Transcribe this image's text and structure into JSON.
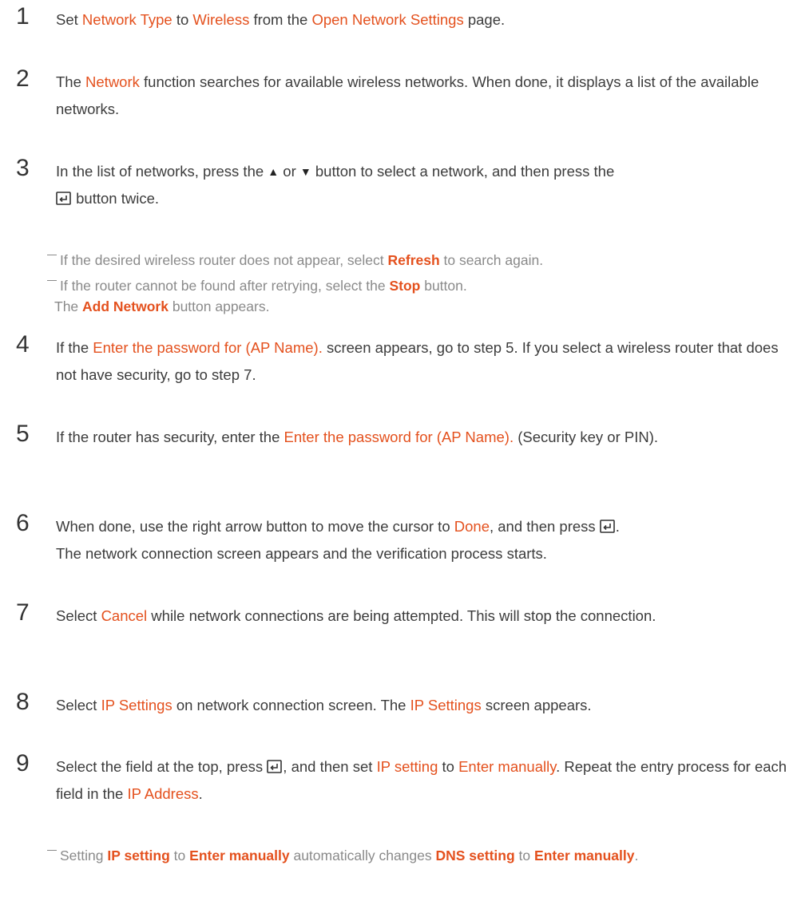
{
  "steps": [
    {
      "number": "1",
      "parts": [
        "Set ",
        "Network Type",
        " to ",
        "Wireless",
        " from the ",
        "Open Network Settings",
        " page."
      ]
    },
    {
      "number": "2",
      "parts": [
        "The ",
        "Network",
        " function searches for available wireless networks. When done, it displays a list of the available networks."
      ]
    },
    {
      "number": "3",
      "parts": [
        "In the list of networks, press the ",
        "▲",
        " or ",
        "▼",
        " button to select a network, and then press the ",
        " button twice."
      ],
      "notes": [
        {
          "parts": [
            "If the desired wireless router does not appear, select ",
            "Refresh",
            " to search again."
          ]
        },
        {
          "parts": [
            "If the router cannot be found after retrying, select the ",
            "Stop",
            " button."
          ],
          "cont": [
            "The ",
            "Add Network",
            " button appears."
          ]
        }
      ]
    },
    {
      "number": "4",
      "parts": [
        "If the ",
        "Enter the password for (AP Name).",
        " screen appears, go to step 5. If you select a wireless router that does not have security, go to step 7."
      ]
    },
    {
      "number": "5",
      "parts": [
        "If the router has security, enter the ",
        "Enter the password for (AP Name).",
        " (Security key or PIN)."
      ]
    },
    {
      "number": "6",
      "parts": [
        "When done, use the right arrow button to move the cursor to ",
        "Done",
        ", and then press ",
        ".",
        " The network connection screen appears and the verification process starts."
      ]
    },
    {
      "number": "7",
      "parts": [
        "Select ",
        "Cancel",
        " while network connections are being attempted. This will stop the connection."
      ]
    },
    {
      "number": "8",
      "parts": [
        "Select ",
        "IP Settings",
        " on network connection screen. The ",
        "IP Settings",
        " screen appears."
      ]
    },
    {
      "number": "9",
      "parts": [
        "Select the field at the top, press ",
        ", and then set ",
        "IP setting",
        " to ",
        "Enter manually",
        ". Repeat the entry process for each field in the ",
        "IP Address",
        "."
      ],
      "notes": [
        {
          "parts": [
            "Setting ",
            "IP setting",
            " to ",
            "Enter manually",
            " automatically changes ",
            "DNS setting",
            " to ",
            "Enter manually",
            "."
          ]
        }
      ]
    }
  ],
  "icons": {
    "up": "triangle-up-icon",
    "down": "triangle-down-icon",
    "enter": "enter-key-icon"
  },
  "colors": {
    "highlight": "#e4511e",
    "text": "#3c3c3c",
    "note": "#8a8a8a"
  }
}
